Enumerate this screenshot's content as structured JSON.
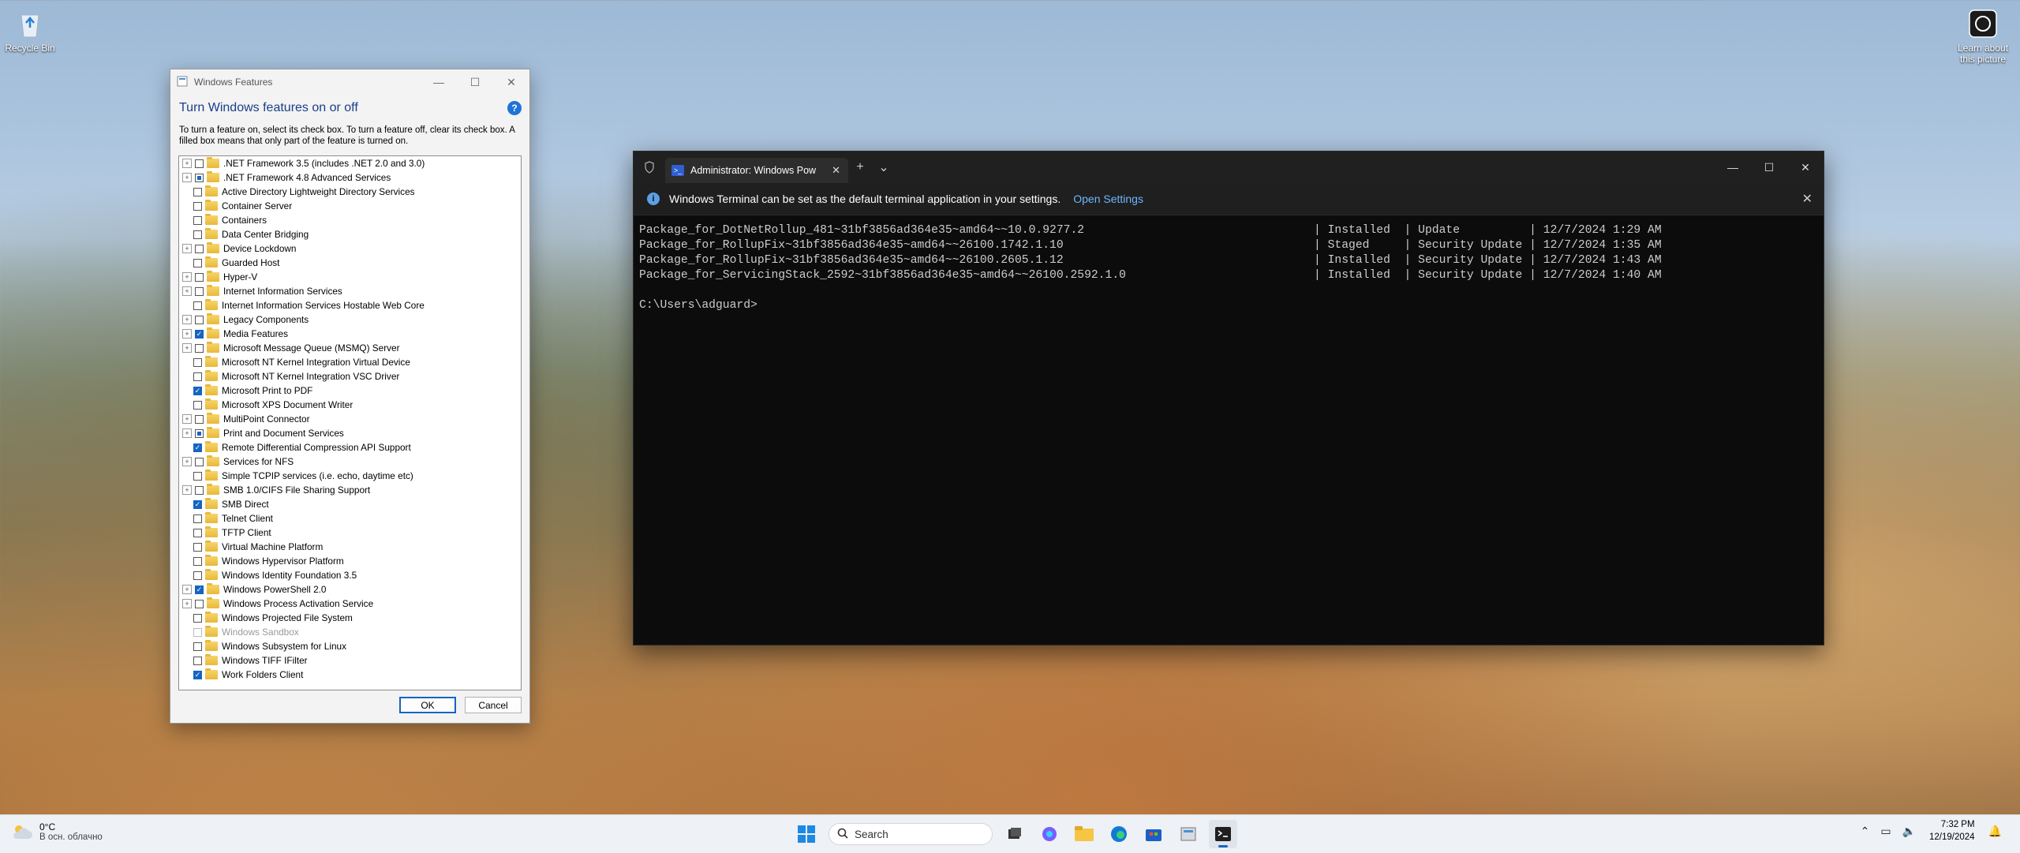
{
  "desktop": {
    "recycle_bin": "Recycle Bin",
    "learn_picture": "Learn about this picture"
  },
  "windows_features": {
    "title": "Windows Features",
    "heading": "Turn Windows features on or off",
    "help": "?",
    "description": "To turn a feature on, select its check box. To turn a feature off, clear its check box. A filled box means that only part of the feature is turned on.",
    "ok": "OK",
    "cancel": "Cancel",
    "features": [
      {
        "label": ".NET Framework 3.5 (includes .NET 2.0 and 3.0)",
        "expandable": true,
        "state": "unchecked"
      },
      {
        "label": ".NET Framework 4.8 Advanced Services",
        "expandable": true,
        "state": "partial"
      },
      {
        "label": "Active Directory Lightweight Directory Services",
        "expandable": false,
        "state": "unchecked"
      },
      {
        "label": "Container Server",
        "expandable": false,
        "state": "unchecked"
      },
      {
        "label": "Containers",
        "expandable": false,
        "state": "unchecked"
      },
      {
        "label": "Data Center Bridging",
        "expandable": false,
        "state": "unchecked"
      },
      {
        "label": "Device Lockdown",
        "expandable": true,
        "state": "unchecked"
      },
      {
        "label": "Guarded Host",
        "expandable": false,
        "state": "unchecked"
      },
      {
        "label": "Hyper-V",
        "expandable": true,
        "state": "unchecked"
      },
      {
        "label": "Internet Information Services",
        "expandable": true,
        "state": "unchecked"
      },
      {
        "label": "Internet Information Services Hostable Web Core",
        "expandable": false,
        "state": "unchecked"
      },
      {
        "label": "Legacy Components",
        "expandable": true,
        "state": "unchecked"
      },
      {
        "label": "Media Features",
        "expandable": true,
        "state": "checked"
      },
      {
        "label": "Microsoft Message Queue (MSMQ) Server",
        "expandable": true,
        "state": "unchecked"
      },
      {
        "label": "Microsoft NT Kernel Integration Virtual Device",
        "expandable": false,
        "state": "unchecked"
      },
      {
        "label": "Microsoft NT Kernel Integration VSC Driver",
        "expandable": false,
        "state": "unchecked"
      },
      {
        "label": "Microsoft Print to PDF",
        "expandable": false,
        "state": "checked"
      },
      {
        "label": "Microsoft XPS Document Writer",
        "expandable": false,
        "state": "unchecked"
      },
      {
        "label": "MultiPoint Connector",
        "expandable": true,
        "state": "unchecked"
      },
      {
        "label": "Print and Document Services",
        "expandable": true,
        "state": "partial"
      },
      {
        "label": "Remote Differential Compression API Support",
        "expandable": false,
        "state": "checked"
      },
      {
        "label": "Services for NFS",
        "expandable": true,
        "state": "unchecked"
      },
      {
        "label": "Simple TCPIP services (i.e. echo, daytime etc)",
        "expandable": false,
        "state": "unchecked"
      },
      {
        "label": "SMB 1.0/CIFS File Sharing Support",
        "expandable": true,
        "state": "unchecked"
      },
      {
        "label": "SMB Direct",
        "expandable": false,
        "state": "checked"
      },
      {
        "label": "Telnet Client",
        "expandable": false,
        "state": "unchecked"
      },
      {
        "label": "TFTP Client",
        "expandable": false,
        "state": "unchecked"
      },
      {
        "label": "Virtual Machine Platform",
        "expandable": false,
        "state": "unchecked"
      },
      {
        "label": "Windows Hypervisor Platform",
        "expandable": false,
        "state": "unchecked"
      },
      {
        "label": "Windows Identity Foundation 3.5",
        "expandable": false,
        "state": "unchecked"
      },
      {
        "label": "Windows PowerShell 2.0",
        "expandable": true,
        "state": "checked"
      },
      {
        "label": "Windows Process Activation Service",
        "expandable": true,
        "state": "unchecked"
      },
      {
        "label": "Windows Projected File System",
        "expandable": false,
        "state": "unchecked"
      },
      {
        "label": "Windows Sandbox",
        "expandable": false,
        "state": "disabled"
      },
      {
        "label": "Windows Subsystem for Linux",
        "expandable": false,
        "state": "unchecked"
      },
      {
        "label": "Windows TIFF IFilter",
        "expandable": false,
        "state": "unchecked"
      },
      {
        "label": "Work Folders Client",
        "expandable": false,
        "state": "checked"
      }
    ]
  },
  "terminal": {
    "tab_title": "Administrator: Windows Pow",
    "info_text": "Windows Terminal can be set as the default terminal application in your settings.",
    "info_link": "Open Settings",
    "output": "Package_for_DotNetRollup_481~31bf3856ad364e35~amd64~~10.0.9277.2                                 | Installed  | Update          | 12/7/2024 1:29 AM\nPackage_for_RollupFix~31bf3856ad364e35~amd64~~26100.1742.1.10                                    | Staged     | Security Update | 12/7/2024 1:35 AM\nPackage_for_RollupFix~31bf3856ad364e35~amd64~~26100.2605.1.12                                    | Installed  | Security Update | 12/7/2024 1:43 AM\nPackage_for_ServicingStack_2592~31bf3856ad364e35~amd64~~26100.2592.1.0                           | Installed  | Security Update | 12/7/2024 1:40 AM\n\nC:\\Users\\adguard>"
  },
  "taskbar": {
    "weather_temp": "0°C",
    "weather_desc": "В осн. облачно",
    "search_placeholder": "Search",
    "time": "7:32 PM",
    "date": "12/19/2024"
  }
}
